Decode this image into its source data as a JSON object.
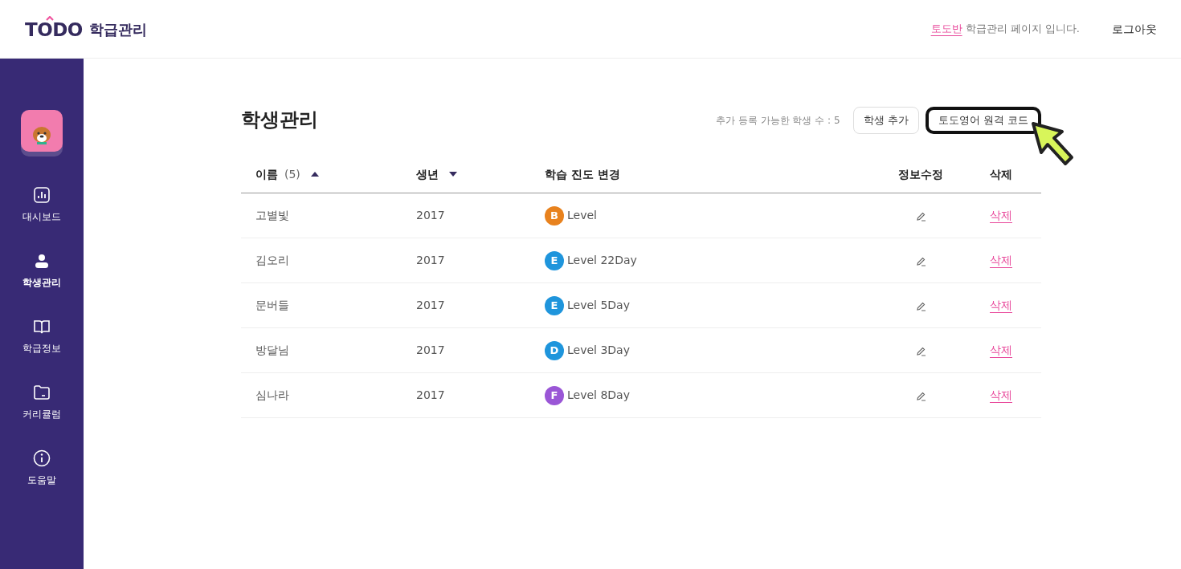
{
  "header": {
    "logo_text": "TODO",
    "logo_subtitle": "학급관리",
    "class_link": "토도반",
    "class_text": "학급관리 페이지 입니다.",
    "logout": "로그아웃"
  },
  "sidebar": {
    "items": [
      {
        "label": "대시보드",
        "selected": false
      },
      {
        "label": "학생관리",
        "selected": true
      },
      {
        "label": "학급정보",
        "selected": false
      },
      {
        "label": "커리큘럼",
        "selected": false
      },
      {
        "label": "도움말",
        "selected": false
      }
    ]
  },
  "page": {
    "title": "학생관리",
    "available_count": "추가 등록 가능한 학생 수 : 5",
    "buttons": [
      {
        "label": "학생 추가",
        "highlighted": false
      },
      {
        "label": "토도영어 원격 코드",
        "highlighted": true
      }
    ]
  },
  "table": {
    "columns": [
      {
        "label": "이름",
        "count": "(5)",
        "sorted": true,
        "descending": false
      },
      {
        "label": "생년",
        "sorted": true,
        "descending": true
      },
      {
        "label": "학습 진도 변경"
      },
      {
        "label": "정보수정"
      },
      {
        "label": "삭제"
      }
    ],
    "rows": [
      {
        "name": "고별빛",
        "year": "2017",
        "grade": "B",
        "color": "#e8821e",
        "progress": "Level",
        "delete": "삭제"
      },
      {
        "name": "김오리",
        "year": "2017",
        "grade": "E",
        "color": "#1f95dc",
        "progress": "Level 22Day",
        "delete": "삭제"
      },
      {
        "name": "문버들",
        "year": "2017",
        "grade": "E",
        "color": "#1f95dc",
        "progress": "Level 5Day",
        "delete": "삭제"
      },
      {
        "name": "방달님",
        "year": "2017",
        "grade": "D",
        "color": "#1f95dc",
        "progress": "Level 3Day",
        "delete": "삭제"
      },
      {
        "name": "심나라",
        "year": "2017",
        "grade": "F",
        "color": "#9a56d6",
        "progress": "Level 8Day",
        "delete": "삭제"
      }
    ]
  }
}
